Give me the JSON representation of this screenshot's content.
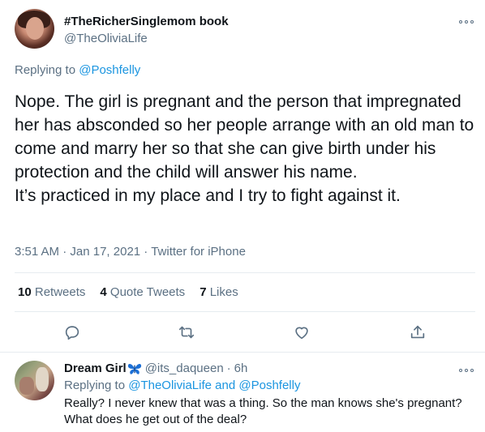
{
  "tweet": {
    "display_name": "#TheRicherSinglemom book",
    "handle": "@TheOliviaLife",
    "replying_prefix": "Replying to ",
    "replying_to": "@Poshfelly",
    "text": "Nope. The girl is pregnant and the person that impregnated her has absconded so her people arrange with an old man to come and marry her so that she can give birth under his protection and the child will answer his name.\nIt’s practiced in my place and I try to fight against it.",
    "time": "3:51 AM",
    "date": "Jan 17, 2021",
    "sep": " · ",
    "source": "Twitter for iPhone",
    "stats": {
      "retweets_count": "10",
      "retweets_label": "Retweets",
      "quotes_count": "4",
      "quotes_label": "Quote Tweets",
      "likes_count": "7",
      "likes_label": "Likes"
    },
    "icons": {
      "more": "more-icon",
      "reply": "reply-icon",
      "retweet": "retweet-icon",
      "like": "heart-icon",
      "share": "share-icon"
    }
  },
  "reply": {
    "display_name": "Dream Girl",
    "name_emoji": "butterfly-icon",
    "handle": "@its_daqueen",
    "sep": "·",
    "time": "6h",
    "replying_prefix": "Replying to ",
    "replying_to_1": "@TheOliviaLife",
    "replying_and": " and ",
    "replying_to_2": "@Poshfelly",
    "text": "Really? I never knew that was a thing. So the man knows she's pregnant? What does he get out of the deal?"
  },
  "colors": {
    "link": "#1b95e0",
    "secondary": "#5b7083",
    "primary_text": "#0f1419",
    "divider": "#e6ecf0",
    "butterfly": "#1b6fd6"
  }
}
